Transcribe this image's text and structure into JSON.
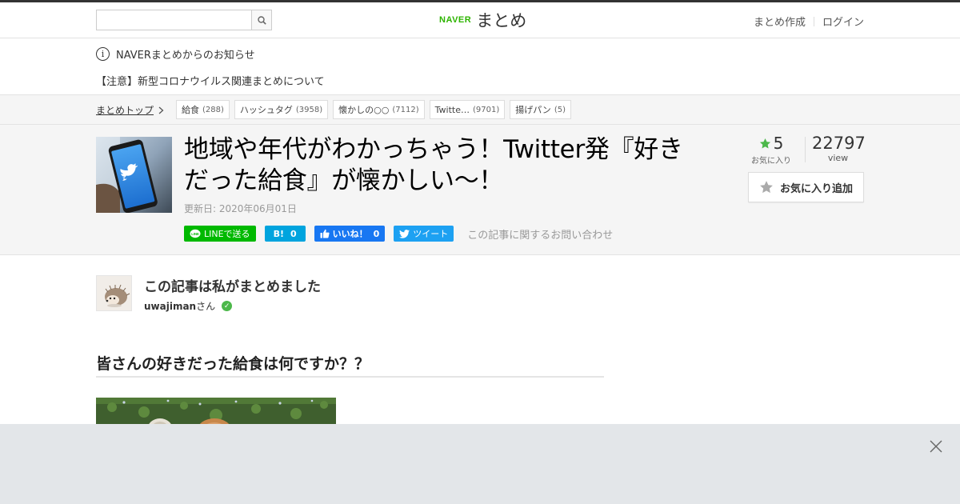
{
  "header": {
    "search": {
      "value": "",
      "placeholder": ""
    },
    "logo": {
      "brand": "NAVER",
      "product": "まとめ"
    },
    "nav": {
      "create": "まとめ作成",
      "login": "ログイン"
    }
  },
  "notice": {
    "heading": "NAVERまとめからのお知らせ",
    "link": "【注意】新型コロナウイルス関連まとめについて"
  },
  "tagbar": {
    "breadcrumb": "まとめトップ",
    "tags": [
      {
        "label": "給食",
        "count": "(288)"
      },
      {
        "label": "ハッシュタグ",
        "count": "(3958)"
      },
      {
        "label": "懐かしの○○",
        "count": "(7112)"
      },
      {
        "label": "Twitte…",
        "count": "(9701)"
      },
      {
        "label": "揚げパン",
        "count": "(5)"
      }
    ]
  },
  "article": {
    "title": "地域や年代がわかっちゃう！Twitter発『好きだった給食』が懐かしい～！",
    "updated": "更新日: 2020年06月01日",
    "share": {
      "line": "LINEで送る",
      "hatena_label": "B!",
      "hatena_count": "0",
      "facebook_label": "いいね！",
      "facebook_count": "0",
      "tweet": "ツイート",
      "inquiry": "この記事に関するお問い合わせ"
    },
    "stats": {
      "favorites": "5",
      "favorites_label": "お気に入り",
      "views": "22797",
      "views_label": "view"
    },
    "favorite_button": "お気に入り追加"
  },
  "author": {
    "heading": "この記事は私がまとめました",
    "name": "uwajiman",
    "suffix": "さん"
  },
  "section": {
    "heading": "皆さんの好きだった給食は何ですか？？"
  },
  "colors": {
    "naver_green": "#2db400",
    "line_green": "#00b900",
    "hatena_blue": "#00a4de",
    "facebook_blue": "#1877f2",
    "twitter_blue": "#1da1f2",
    "star_green": "#4cb84a"
  }
}
